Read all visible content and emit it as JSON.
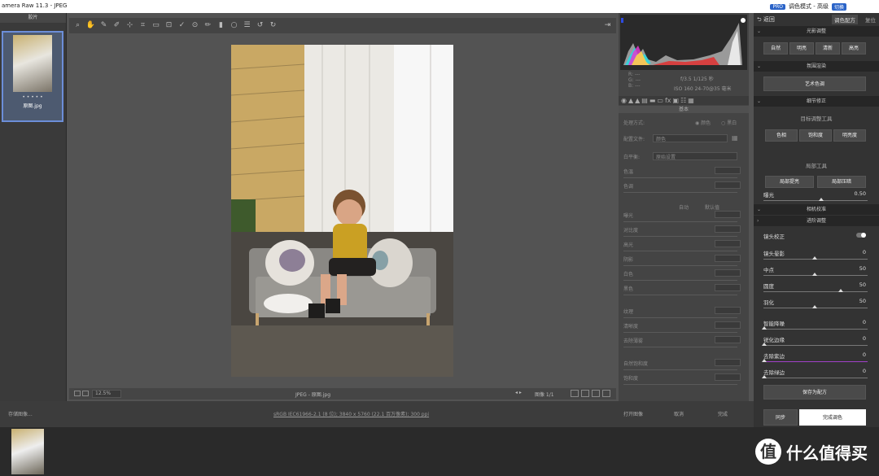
{
  "titlebar": {
    "title": "amera Raw 11.3 -  JPEG",
    "badge": "PRO",
    "mode": "调色模式 - 高级",
    "switch": "切换"
  },
  "filmstrip": {
    "header": "胶片",
    "stars": "• • • • •",
    "filename": "原图.jpg"
  },
  "toolbar": {
    "icons": [
      "zoom-icon",
      "hand-icon",
      "eyedropper-icon",
      "color-sampler-icon",
      "target-icon",
      "crop-icon",
      "straighten-icon",
      "transform-icon",
      "spot-removal-icon",
      "redeye-icon",
      "brush-icon",
      "graduated-filter-icon",
      "radial-filter-icon",
      "list-icon",
      "rotate-left-icon",
      "rotate-right-icon"
    ],
    "exit": "⇥"
  },
  "preview": {
    "zoom": "12.5%",
    "center_text": "JPEG -  原图.jpg",
    "image_label": "图像 1/1"
  },
  "histogram": {
    "r": "R:",
    "g": "G:",
    "b": "B:",
    "dash": "---",
    "exif1": "f/3.5   1/125 秒",
    "exif2": "ISO 160   24-70@35 毫米"
  },
  "basic": {
    "section": "基本",
    "process_label": "处理方式:",
    "process_color": "颜色",
    "process_bw": "黑白",
    "profile_label": "配置文件:",
    "profile_value": "颜色",
    "wb_label": "白平衡:",
    "wb_value": "原始设置",
    "sliders_a": [
      "色温",
      "色调"
    ],
    "auto": "自动",
    "default": "默认值",
    "sliders_b": [
      "曝光",
      "对比度",
      "高光",
      "阴影",
      "白色",
      "黑色"
    ],
    "sliders_c": [
      "纹理",
      "清晰度",
      "去除薄雾"
    ],
    "sliders_d": [
      "自然饱和度",
      "饱和度"
    ]
  },
  "right": {
    "back": "返回",
    "tab_active": "调色配方",
    "tab_other": "复位",
    "sec_light": "光影调整",
    "light_btns": [
      "自然",
      "明亮",
      "清新",
      "高亮"
    ],
    "sec_render": "氛围渲染",
    "art_btn": "艺术色调",
    "sec_detail": "细节修正",
    "target_tool": "目标调整工具",
    "target_btns": [
      "色相",
      "饱和度",
      "明亮度"
    ],
    "local_tool": "局部工具",
    "local_btns": [
      "局部提亮",
      "局部压暗"
    ],
    "exposure_label": "曝光",
    "exposure_value": "0.50",
    "sec_camera": "相机校准",
    "sec_advanced": "进阶调整",
    "lens_label": "镜头校正",
    "vignette_label": "镜头晕影",
    "vignette_value": "0",
    "midpoint_label": "中点",
    "midpoint_value": "50",
    "roundness_label": "圆度",
    "roundness_value": "50",
    "feather_label": "羽化",
    "feather_value": "50",
    "noise_label": "智能降噪",
    "noise_value": "0",
    "sharpen_label": "锐化边缘",
    "sharpen_value": "0",
    "defringe_label": "去除紫边",
    "defringe_value": "0",
    "defringe_green_label": "去除绿边",
    "defringe_green_value": "0",
    "save_preset": "保存为配方",
    "sync": "同步",
    "done": "完成调色"
  },
  "footer": {
    "save": "存储图像...",
    "info": "sRGB IEC61966-2.1 (8 位); 3840 x 5760 (22.1 百万像素); 300 ppi",
    "open": "打开图像",
    "cancel": "取消",
    "done": "完成"
  },
  "watermark": {
    "circle": "值",
    "text": "什么值得买"
  }
}
